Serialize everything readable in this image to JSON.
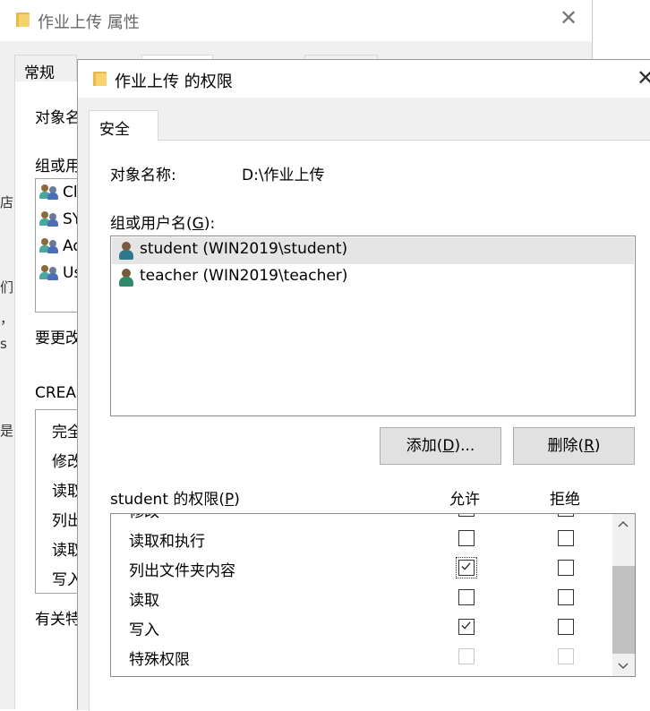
{
  "background_window": {
    "title": "作业上传 属性",
    "tabs": [
      "常规"
    ],
    "fragments": {
      "object_name": "对象名",
      "group_or_user": "组或用",
      "users": [
        "Cl",
        "SY",
        "Ad",
        "Us"
      ],
      "change_hint": "要更改",
      "creator": "CREA",
      "perms": [
        "完全",
        "修改",
        "读取",
        "列出",
        "读取",
        "写入"
      ],
      "footer": "有关特"
    },
    "left_fragments": [
      "店",
      "们",
      "，",
      "s",
      "是"
    ]
  },
  "dialog": {
    "title": "作业上传 的权限",
    "tab_security": "安全",
    "object_name_label": "对象名称:",
    "object_name_value": "D:\\作业上传",
    "group_label": "组或用户名(",
    "group_key": "G",
    "group_label_end": "):",
    "users": [
      {
        "name": "student (WIN2019\\student)",
        "selected": true
      },
      {
        "name": "teacher (WIN2019\\teacher)",
        "selected": false
      }
    ],
    "add_button": {
      "text": "添加(",
      "key": "D",
      "end": ")..."
    },
    "remove_button": {
      "text": "删除(",
      "key": "R",
      "end": ")"
    },
    "perms_label": "student 的权限(",
    "perms_key": "P",
    "perms_label_end": ")",
    "allow_header": "允许",
    "deny_header": "拒绝",
    "partial_row": "修改",
    "permissions": [
      {
        "name": "读取和执行",
        "allow": false,
        "deny": false,
        "disabled": false
      },
      {
        "name": "列出文件夹内容",
        "allow": true,
        "deny": false,
        "disabled": false
      },
      {
        "name": "读取",
        "allow": false,
        "deny": false,
        "disabled": false
      },
      {
        "name": "写入",
        "allow": true,
        "deny": false,
        "disabled": false
      },
      {
        "name": "特殊权限",
        "allow": false,
        "deny": false,
        "disabled": true
      }
    ]
  },
  "colors": {
    "accent": "#0078d7",
    "selection": "#e5e5e5",
    "button": "#e1e1e1"
  }
}
